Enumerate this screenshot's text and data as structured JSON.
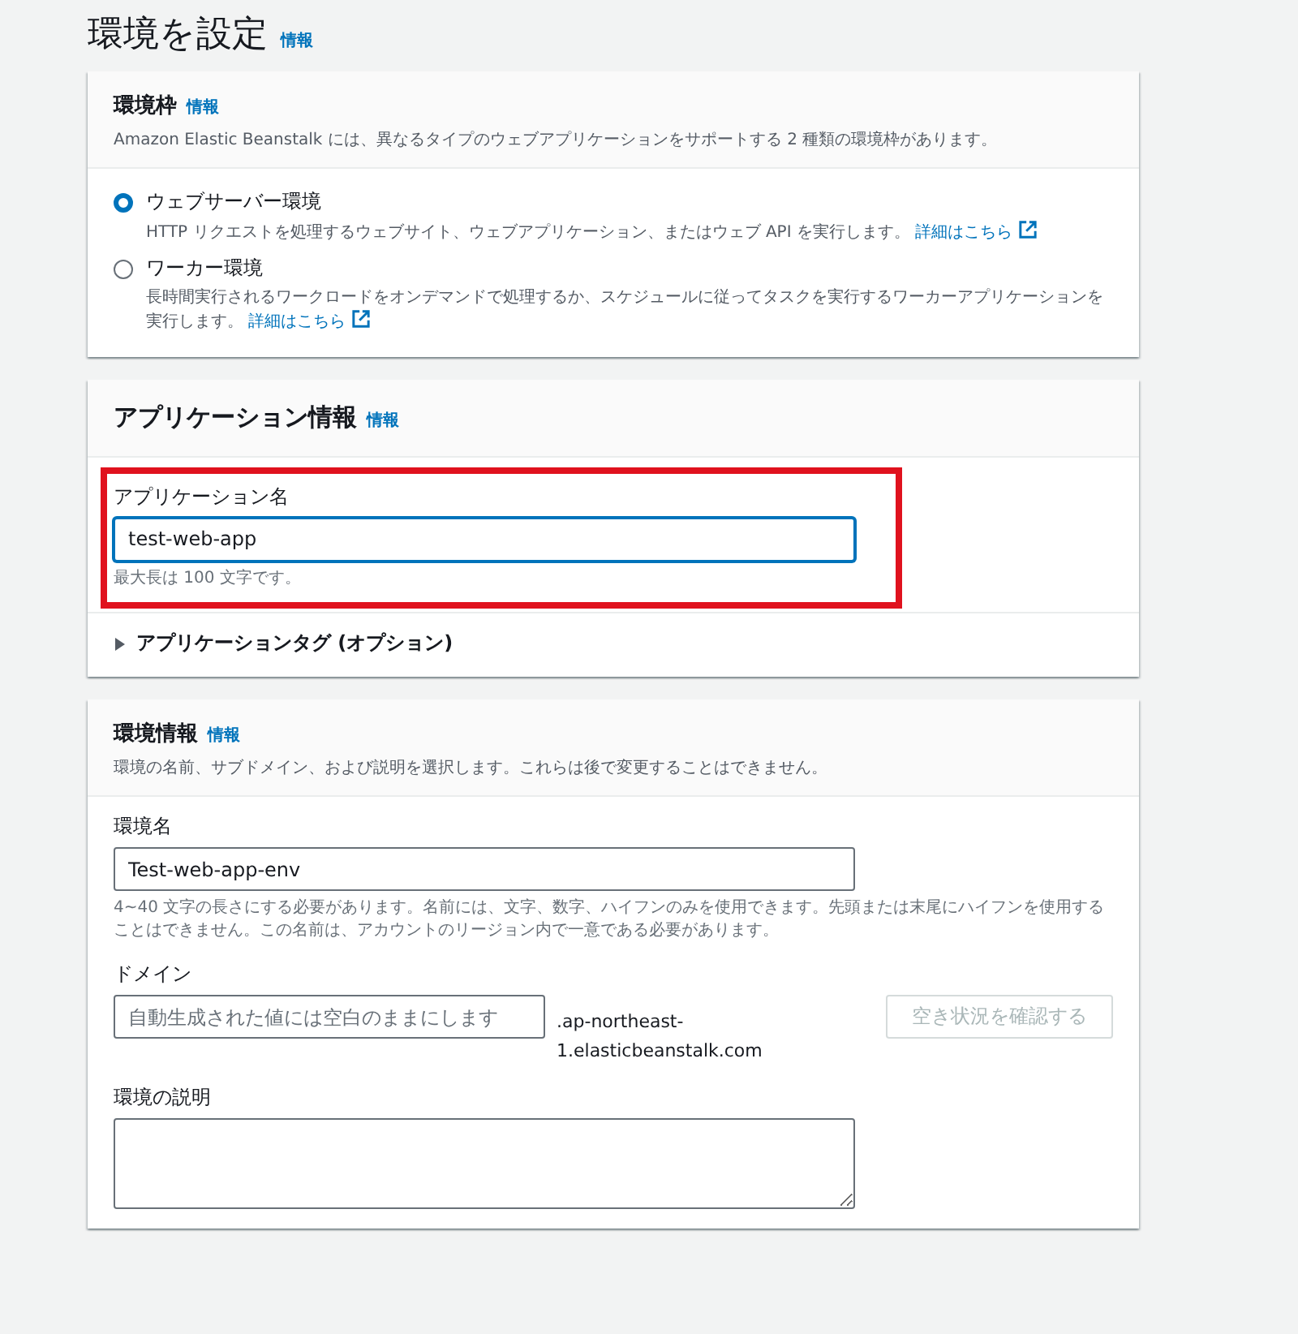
{
  "page": {
    "title": "環境を設定",
    "info_link": "情報"
  },
  "environment_tier": {
    "title": "環境枠",
    "info_link": "情報",
    "description": "Amazon Elastic Beanstalk には、異なるタイプのウェブアプリケーションをサポートする 2 種類の環境枠があります。",
    "options": [
      {
        "label": "ウェブサーバー環境",
        "description": "HTTP リクエストを処理するウェブサイト、ウェブアプリケーション、またはウェブ API を実行します。",
        "link": "詳細はこちら",
        "selected": true
      },
      {
        "label": "ワーカー環境",
        "description": "長時間実行されるワークロードをオンデマンドで処理するか、スケジュールに従ってタスクを実行するワーカーアプリケーションを実行します。",
        "link": "詳細はこちら",
        "selected": false
      }
    ]
  },
  "application_info": {
    "title": "アプリケーション情報",
    "info_link": "情報",
    "name_field": {
      "label": "アプリケーション名",
      "value": "test-web-app",
      "hint": "最大長は 100 文字です。",
      "focused": true,
      "highlighted": true
    },
    "tags": {
      "label": "アプリケーションタグ (オプション)",
      "expanded": false
    }
  },
  "environment_info": {
    "title": "環境情報",
    "info_link": "情報",
    "description": "環境の名前、サブドメイン、および説明を選択します。これらは後で変更することはできません。",
    "name_field": {
      "label": "環境名",
      "value": "Test-web-app-env",
      "hint": "4~40 文字の長さにする必要があります。名前には、文字、数字、ハイフンのみを使用できます。先頭または末尾にハイフンを使用することはできません。この名前は、アカウントのリージョン内で一意である必要があります。"
    },
    "domain": {
      "label": "ドメイン",
      "placeholder": "自動生成された値には空白のままにします",
      "suffix_line_1": ".ap-northeast-",
      "suffix_line_2": "1.elasticbeanstalk.com",
      "check_button": {
        "label": "空き状況を確認する",
        "disabled": true
      }
    },
    "description_field": {
      "label": "環境の説明"
    }
  }
}
